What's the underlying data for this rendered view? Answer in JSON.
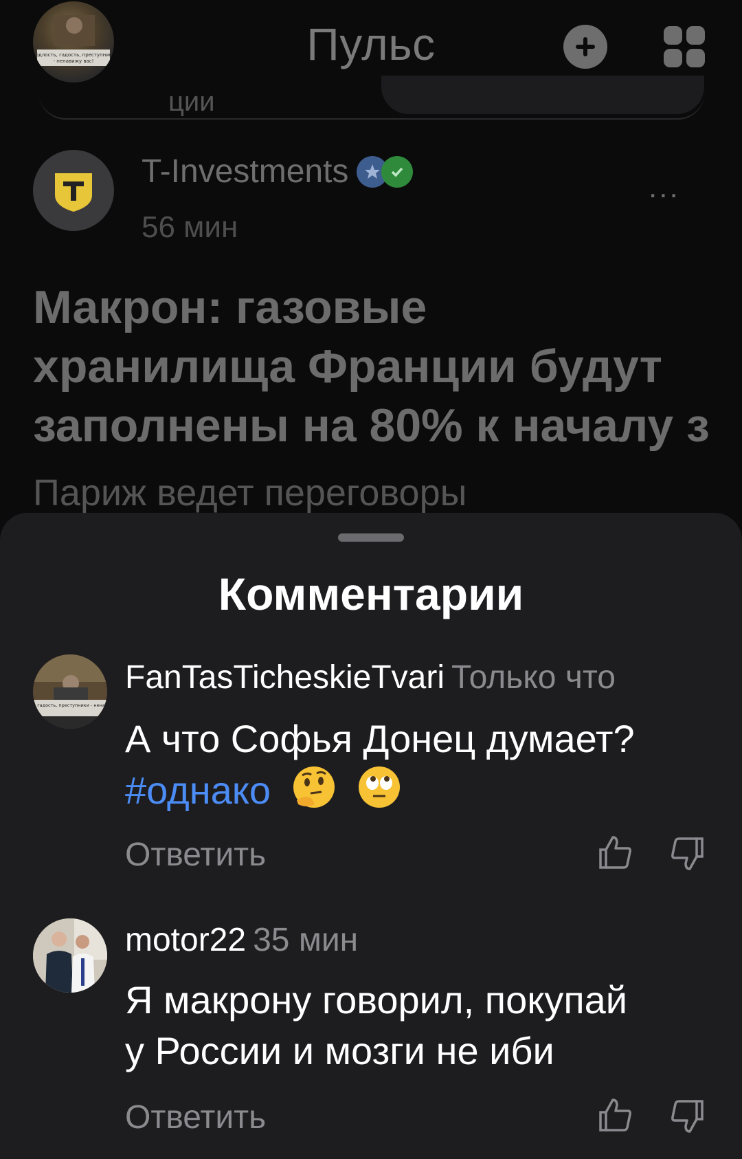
{
  "header": {
    "title": "Пульс",
    "avatar_caption": "Подлость, гадость, преступники - ненавижу вас!"
  },
  "previous_card": {
    "partial_text": "ции"
  },
  "post": {
    "author": "T-Investments",
    "time": "56 мин",
    "more": "...",
    "headline_lines": [
      "Макрон: газовые",
      "хранилища Франции будут",
      "заполнены на 80% к началу з"
    ],
    "lead": "Париж ведет переговоры"
  },
  "comments_sheet": {
    "title": "Комментарии",
    "comments": [
      {
        "author": "FanTasTicheskieTvari",
        "time": "Только что",
        "text": "А что Софья Донец думает?",
        "hashtag": "#однако",
        "emojis": [
          "thinking-face",
          "eye-roll-face"
        ],
        "reply_label": "Ответить",
        "avatar_caption": "Подлость, гадость, преступники - ненавижу вас!"
      },
      {
        "author": "motor22",
        "time": "35 мин",
        "text_lines": [
          "Я макрону говорил, покупай",
          "у России и мозги не иби"
        ],
        "reply_label": "Ответить"
      }
    ]
  },
  "colors": {
    "sheet_bg": "#1d1d20",
    "hashtag": "#4c8cf5",
    "muted": "#8a8a8f"
  }
}
